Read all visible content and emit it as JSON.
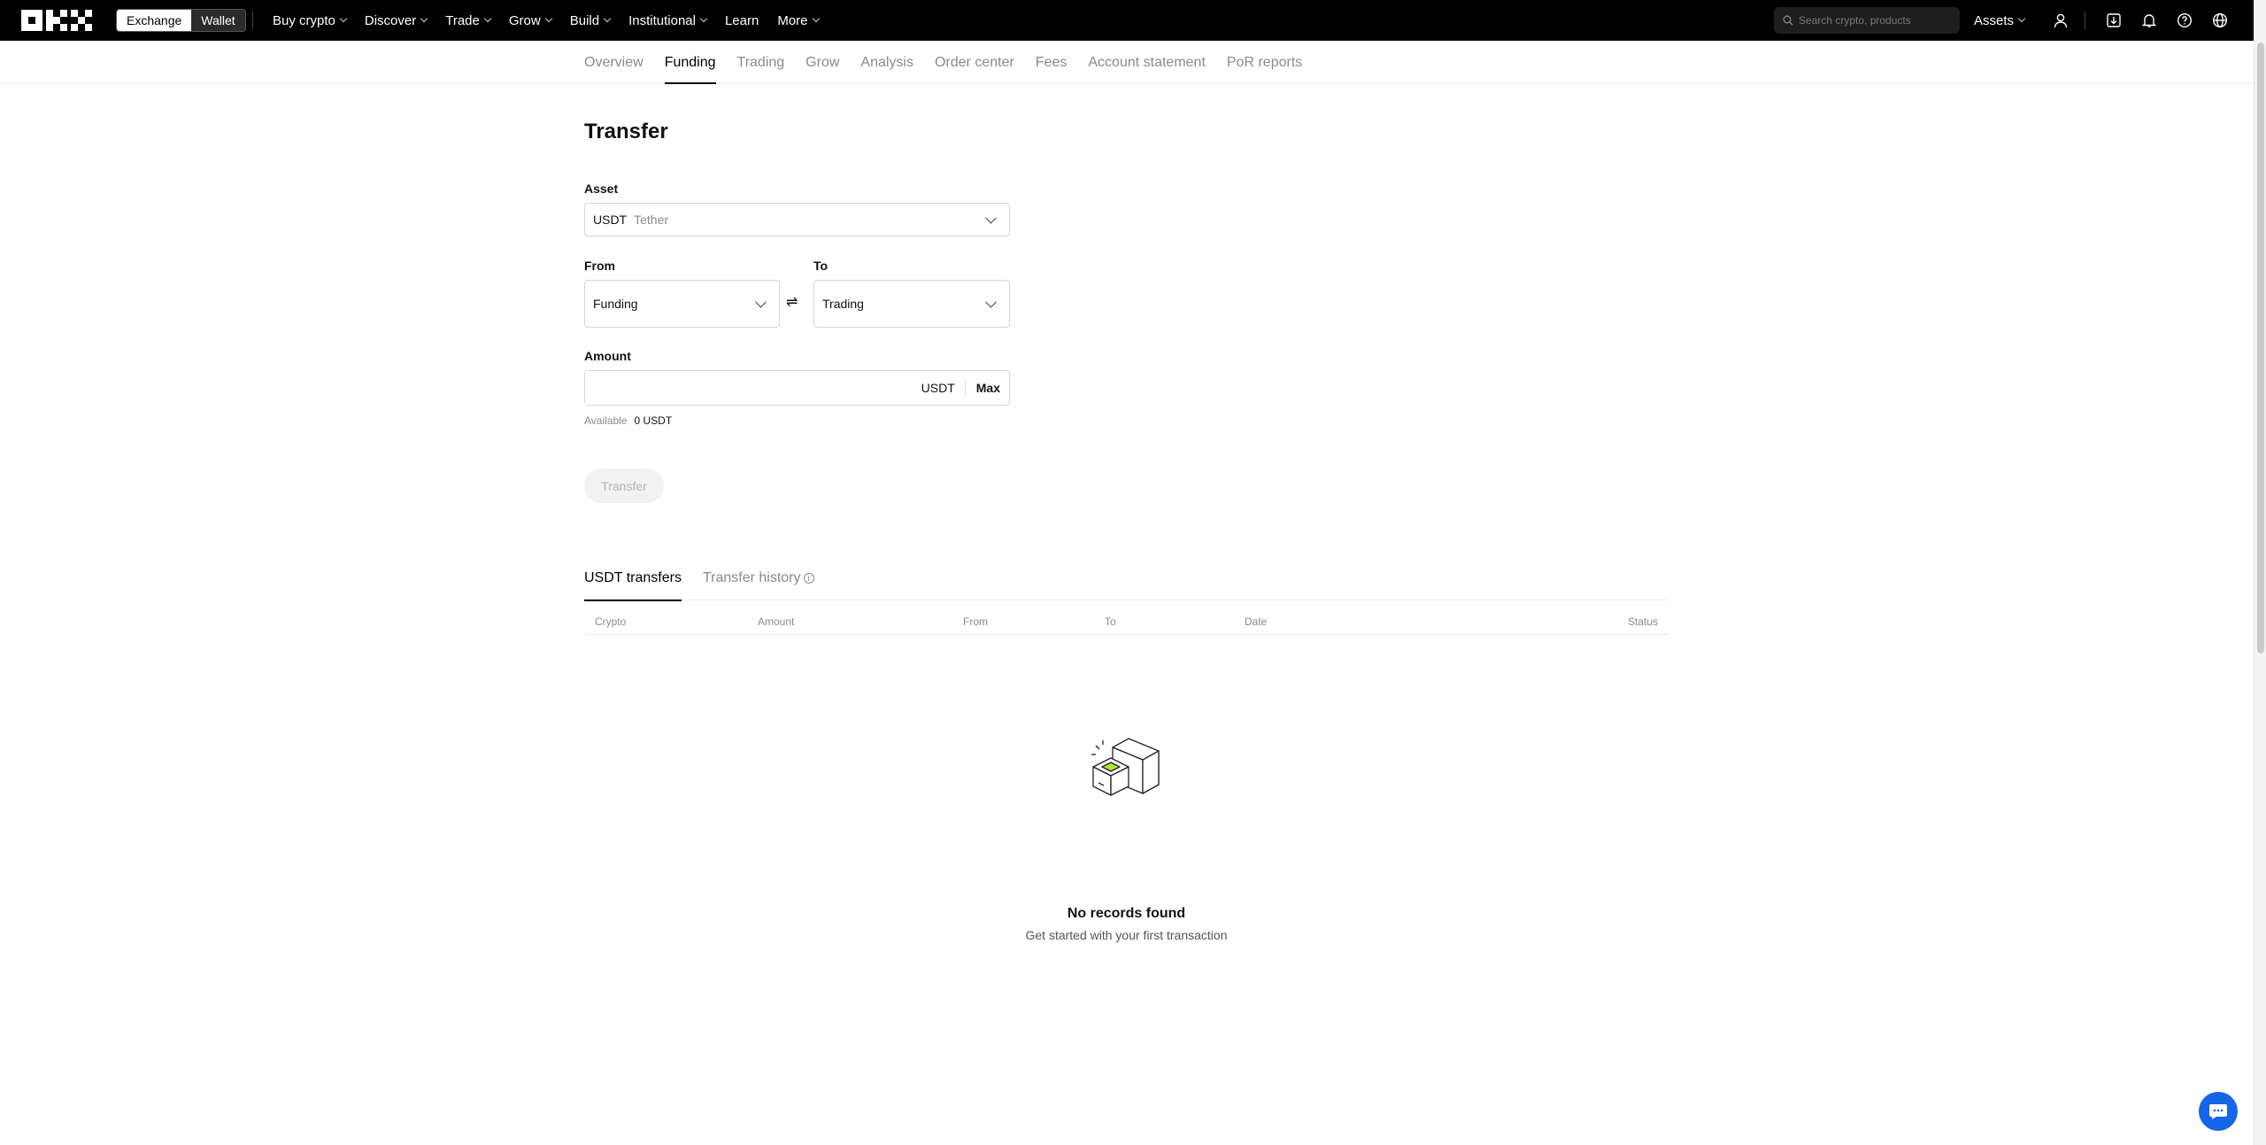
{
  "header": {
    "logo_label": "OKX",
    "mode_exchange": "Exchange",
    "mode_wallet": "Wallet",
    "nav": [
      {
        "label": "Buy crypto",
        "dropdown": true
      },
      {
        "label": "Discover",
        "dropdown": true
      },
      {
        "label": "Trade",
        "dropdown": true
      },
      {
        "label": "Grow",
        "dropdown": true
      },
      {
        "label": "Build",
        "dropdown": true
      },
      {
        "label": "Institutional",
        "dropdown": true
      },
      {
        "label": "Learn",
        "dropdown": false
      },
      {
        "label": "More",
        "dropdown": true
      }
    ],
    "search_placeholder": "Search crypto, products",
    "assets_label": "Assets"
  },
  "subnav": {
    "items": [
      "Overview",
      "Funding",
      "Trading",
      "Grow",
      "Analysis",
      "Order center",
      "Fees",
      "Account statement",
      "PoR reports"
    ],
    "active": "Funding"
  },
  "transfer": {
    "title": "Transfer",
    "asset_label": "Asset",
    "asset_symbol": "USDT",
    "asset_name": "Tether",
    "from_label": "From",
    "from_value": "Funding",
    "to_label": "To",
    "to_value": "Trading",
    "swap_glyph": "⇌",
    "amount_label": "Amount",
    "amount_value": "",
    "amount_unit": "USDT",
    "max_label": "Max",
    "available_label": "Available",
    "available_value": "0 USDT",
    "button_label": "Transfer"
  },
  "records": {
    "tab_active": "USDT transfers",
    "tab_history": "Transfer history",
    "columns": [
      "Crypto",
      "Amount",
      "From",
      "To",
      "Date",
      "Status"
    ],
    "empty_title": "No records found",
    "empty_subtitle": "Get started with your first transaction"
  },
  "colors": {
    "topbar_bg": "#000000",
    "accent_chat": "#1565e6",
    "empty_highlight": "#a8e63a"
  }
}
